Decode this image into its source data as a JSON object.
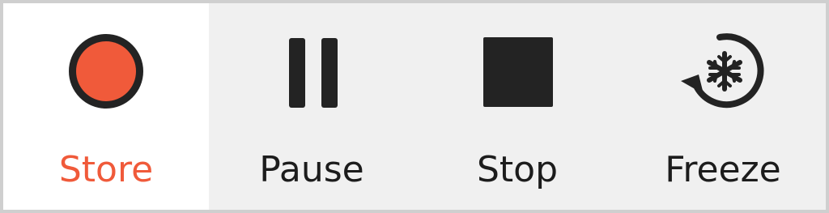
{
  "toolbar": {
    "buttons": [
      {
        "label": "Store",
        "icon": "record-icon",
        "active": true
      },
      {
        "label": "Pause",
        "icon": "pause-icon",
        "active": false
      },
      {
        "label": "Stop",
        "icon": "stop-icon",
        "active": false
      },
      {
        "label": "Freeze",
        "icon": "freeze-icon",
        "active": false
      }
    ]
  },
  "colors": {
    "accent": "#f05a3a",
    "icon_dark": "#232323",
    "toolbar_bg": "#f0f0f0",
    "active_bg": "#ffffff",
    "border": "#cfcfcf"
  }
}
